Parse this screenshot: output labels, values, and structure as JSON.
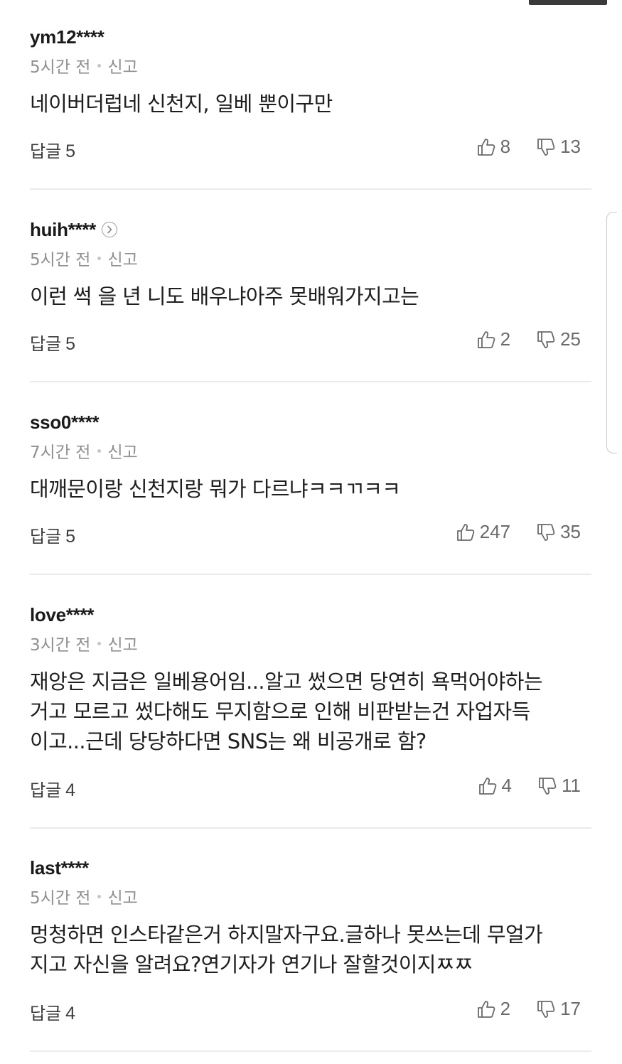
{
  "comments": [
    {
      "user": "ym12****",
      "time": "5시간 전",
      "report": "신고",
      "text": "네이버더럽네 신천지, 일베 뿐이구만",
      "reply_label": "답글",
      "reply_count": "5",
      "likes": "8",
      "dislikes": "13",
      "profile_arrow": false
    },
    {
      "user": "huih****",
      "time": "5시간 전",
      "report": "신고",
      "text": "이런 썩 을 년 니도 배우냐아주 못배워가지고는",
      "reply_label": "답글",
      "reply_count": "5",
      "likes": "2",
      "dislikes": "25",
      "profile_arrow": true
    },
    {
      "user": "sso0****",
      "time": "7시간 전",
      "report": "신고",
      "text": "대깨문이랑 신천지랑 뭐가 다르냐ㅋㅋㄲㅋㅋ",
      "reply_label": "답글",
      "reply_count": "5",
      "likes": "247",
      "dislikes": "35",
      "profile_arrow": false
    },
    {
      "user": "love****",
      "time": "3시간 전",
      "report": "신고",
      "text": "재앙은 지금은 일베용어임...알고 썼으면 당연히 욕먹어야하는\n거고 모르고 썼다해도 무지함으로 인해 비판받는건 자업자득\n이고...근데 당당하다면 SNS는 왜 비공개로 함?",
      "reply_label": "답글",
      "reply_count": "4",
      "likes": "4",
      "dislikes": "11",
      "profile_arrow": false
    },
    {
      "user": "last****",
      "time": "5시간 전",
      "report": "신고",
      "text": "멍청하면 인스타같은거 하지말자구요.글하나 못쓰는데 무얼가\n지고 자신을 알려요?연기자가 연기나 잘할것이지ㅉㅉ",
      "reply_label": "답글",
      "reply_count": "4",
      "likes": "2",
      "dislikes": "17",
      "profile_arrow": false
    }
  ],
  "icons": {
    "like": "thumbs-up-icon",
    "dislike": "thumbs-down-icon",
    "profile": "chevron-right-circle-icon"
  },
  "colors": {
    "text": "#1e1e1e",
    "meta": "#8f8f8f",
    "divider": "#ebebeb"
  }
}
